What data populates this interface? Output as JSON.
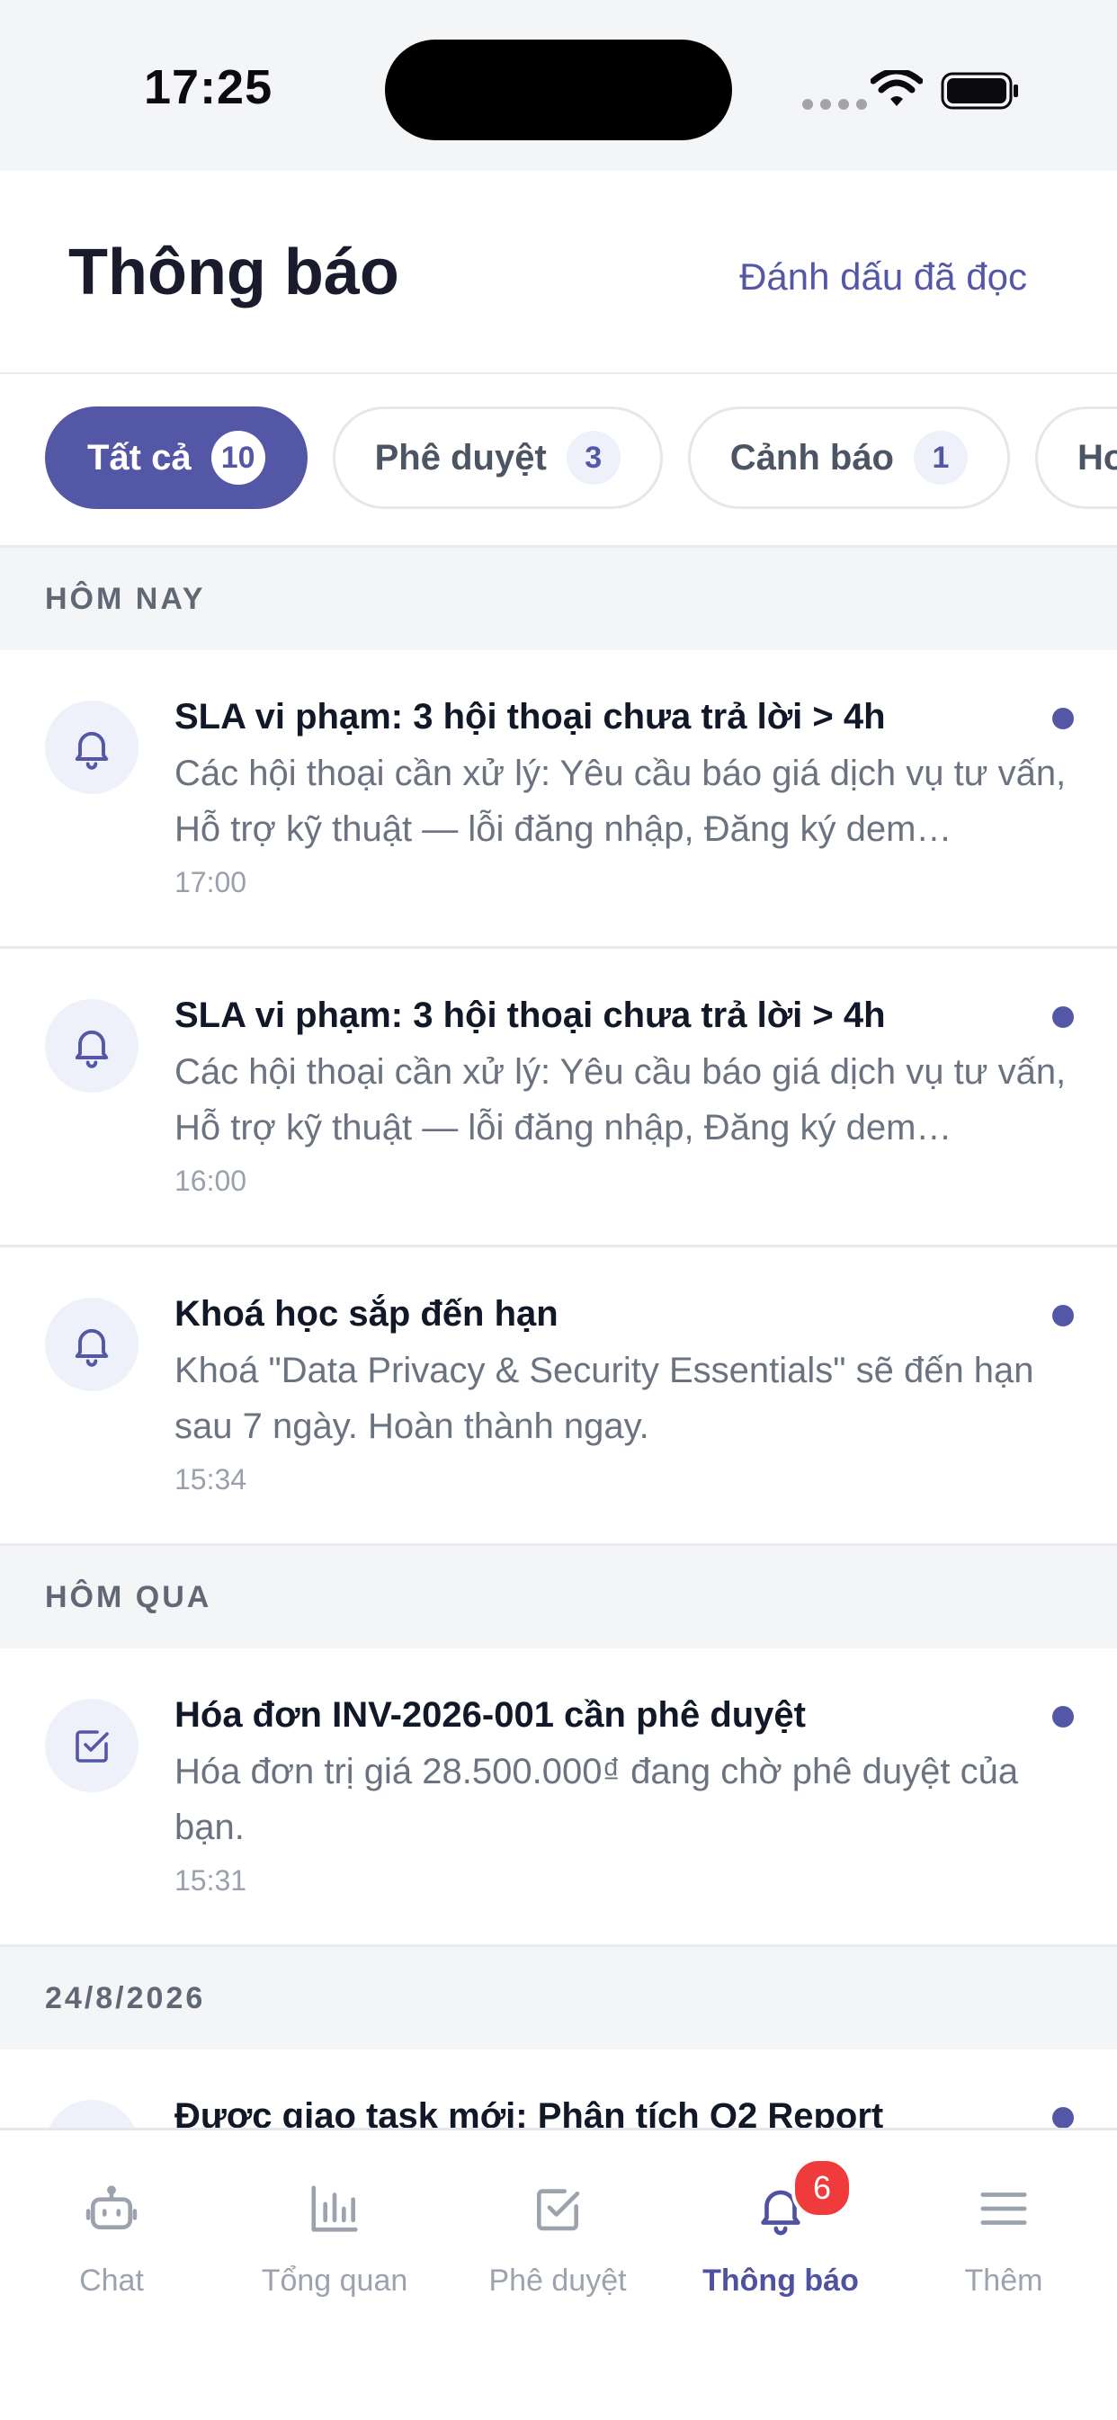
{
  "status_bar": {
    "time": "17:25"
  },
  "header": {
    "title": "Thông báo",
    "mark_read_label": "Đánh dấu đã đọc"
  },
  "filters": [
    {
      "label": "Tất cả",
      "count": "10",
      "active": true
    },
    {
      "label": "Phê duyệt",
      "count": "3",
      "active": false
    },
    {
      "label": "Cảnh báo",
      "count": "1",
      "active": false
    },
    {
      "label": "Ho",
      "count": "",
      "active": false
    }
  ],
  "sections": [
    {
      "label": "HÔM NAY",
      "items": [
        {
          "icon": "bell-icon",
          "title": "SLA vi phạm: 3 hội thoại chưa trả lời > 4h",
          "body": "Các hội thoại cần xử lý: Yêu cầu báo giá dịch vụ tư vấn, Hỗ trợ kỹ thuật — lỗi đăng nhập, Đăng ký dem…",
          "time": "17:00",
          "unread": true
        },
        {
          "icon": "bell-icon",
          "title": "SLA vi phạm: 3 hội thoại chưa trả lời > 4h",
          "body": "Các hội thoại cần xử lý: Yêu cầu báo giá dịch vụ tư vấn, Hỗ trợ kỹ thuật — lỗi đăng nhập, Đăng ký dem…",
          "time": "16:00",
          "unread": true
        },
        {
          "icon": "bell-icon",
          "title": "Khoá học sắp đến hạn",
          "body": "Khoá \"Data Privacy & Security Essentials\" sẽ đến hạn sau 7 ngày. Hoàn thành ngay.",
          "time": "15:34",
          "unread": true
        }
      ]
    },
    {
      "label": "HÔM QUA",
      "items": [
        {
          "icon": "checkbox-icon",
          "title": "Hóa đơn INV-2026-001 cần phê duyệt",
          "body": "Hóa đơn trị giá 28.500.000₫ đang chờ phê duyệt của bạn.",
          "time": "15:31",
          "unread": true
        }
      ]
    },
    {
      "label": "24/8/2026",
      "items": [
        {
          "icon": "bell-icon",
          "title": "Được giao task mới: Phân tích Q2 Report",
          "body": "",
          "time": "",
          "unread": true
        }
      ]
    }
  ],
  "tab_bar": {
    "tabs": [
      {
        "label": "Chat",
        "icon": "robot-icon",
        "active": false
      },
      {
        "label": "Tổng quan",
        "icon": "bar-chart-icon",
        "active": false
      },
      {
        "label": "Phê duyệt",
        "icon": "checkbox-icon",
        "active": false
      },
      {
        "label": "Thông báo",
        "icon": "bell-icon",
        "active": true,
        "badge": "6"
      },
      {
        "label": "Thêm",
        "icon": "menu-icon",
        "active": false
      }
    ]
  },
  "colors": {
    "accent": "#5457a6",
    "badge": "#ef3b3b",
    "muted": "#6b7280"
  }
}
